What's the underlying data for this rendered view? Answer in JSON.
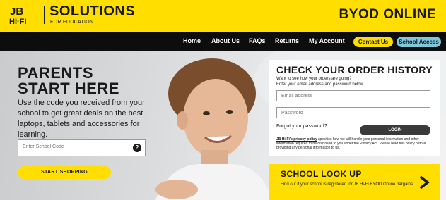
{
  "header": {
    "logo_line1": "JB",
    "logo_line2": "HI·FI",
    "brand_title": "SOLUTIONS",
    "brand_subtitle": "FOR EDUCATION",
    "site_title": "BYOD ONLINE"
  },
  "nav": {
    "items": [
      {
        "label": "Home"
      },
      {
        "label": "About Us"
      },
      {
        "label": "FAQs"
      },
      {
        "label": "Returns"
      },
      {
        "label": "My Account"
      }
    ],
    "contact_label": "Contact Us",
    "school_access_label": "School Access"
  },
  "hero": {
    "heading_line1": "PARENTS",
    "heading_line2": "START HERE",
    "text": "Use the code you received from your school to get great deals on the best laptops, tablets and accessories for learning.",
    "code_placeholder": "Enter School Code",
    "help_icon_glyph": "?",
    "start_label": "START SHOPPING"
  },
  "order": {
    "title": "CHECK YOUR ORDER HISTORY",
    "subtitle_line1": "Want to see how your orders are going?",
    "subtitle_line2": "Enter your email address and password below.",
    "email_placeholder": "Email address",
    "password_placeholder": "Password",
    "forgot_label": "Forgot your password?",
    "login_label": "LOGIN",
    "privacy_link": "JB Hi-Fi's privacy policy",
    "privacy_text": " specifies how we will handle your personal information and other information required to be disclosed to you under the Privacy Act. Please read this policy before providing any personal information to us."
  },
  "lookup": {
    "title": "SCHOOL LOOK UP",
    "text": "Find out if your school is registered for JB Hi-Fi BYOD Online bargains"
  },
  "colors": {
    "brand_yellow": "#ffde00",
    "nav_black": "#0d0d0d",
    "school_access_blue": "#7ec8dc",
    "login_grey": "#3a3a3a"
  },
  "icons": {
    "help": "help-icon",
    "chevron": "chevron-right-icon"
  }
}
